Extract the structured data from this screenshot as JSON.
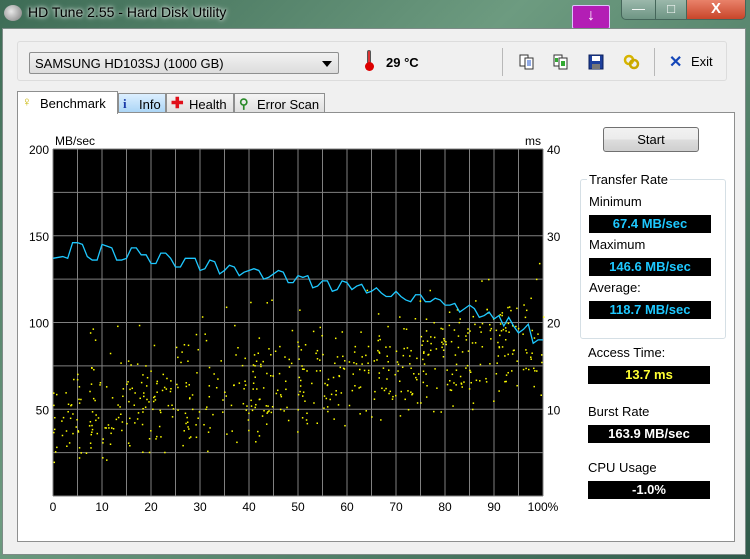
{
  "window": {
    "title": "HD Tune 2.55 - Hard Disk Utility",
    "controls": {
      "download": "↓",
      "minimize": "—",
      "maximize": "□",
      "close": "X"
    }
  },
  "toolbar": {
    "drive": "SAMSUNG HD103SJ (1000 GB)",
    "temperature": "29 °C",
    "icons": [
      "copy-text-icon",
      "copy-image-icon",
      "save-icon",
      "options-icon"
    ],
    "exit_label": "Exit"
  },
  "tabs": [
    {
      "label": "Benchmark",
      "icon": "lightbulb-icon",
      "active": true
    },
    {
      "label": "Info",
      "icon": "info-icon",
      "active": false
    },
    {
      "label": "Health",
      "icon": "health-cross-icon",
      "active": false
    },
    {
      "label": "Error Scan",
      "icon": "magnifier-icon",
      "active": false
    }
  ],
  "side": {
    "start_label": "Start",
    "transfer_rate_title": "Transfer Rate",
    "minimum_label": "Minimum",
    "minimum_value": "67.4 MB/sec",
    "maximum_label": "Maximum",
    "maximum_value": "146.6 MB/sec",
    "average_label": "Average:",
    "average_value": "118.7 MB/sec",
    "access_label": "Access Time:",
    "access_value": "13.7 ms",
    "burst_label": "Burst Rate",
    "burst_value": "163.9 MB/sec",
    "cpu_label": "CPU Usage",
    "cpu_value": "-1.0%"
  },
  "colors": {
    "transfer_line": "#1ec8ff",
    "access_points": "#ffff00",
    "plot_bg": "#000000",
    "grid": "#808080"
  },
  "chart_data": {
    "type": "line",
    "left_axis": {
      "label": "MB/sec",
      "range": [
        0,
        200
      ],
      "ticks": [
        "200",
        "150",
        "100",
        "50"
      ],
      "tick_values": [
        200,
        150,
        100,
        50
      ]
    },
    "right_axis": {
      "label": "ms",
      "range": [
        0,
        40
      ],
      "ticks": [
        "40",
        "30",
        "20",
        "10"
      ],
      "tick_values": [
        40,
        30,
        20,
        10
      ]
    },
    "x_axis": {
      "range": [
        0,
        100
      ],
      "ticks": [
        "0",
        "10",
        "20",
        "30",
        "40",
        "50",
        "60",
        "70",
        "80",
        "90",
        "100%"
      ],
      "tick_values": [
        0,
        10,
        20,
        30,
        40,
        50,
        60,
        70,
        80,
        90,
        100
      ]
    },
    "grid": true,
    "series": [
      {
        "name": "Transfer Rate (MB/sec)",
        "axis": "left",
        "x": [
          0,
          2,
          3,
          4,
          5,
          6,
          7,
          8,
          9,
          10,
          11,
          12,
          13,
          14,
          15,
          16,
          17,
          18,
          19,
          20,
          21,
          22,
          23,
          24,
          25,
          26,
          27,
          28,
          29,
          30,
          31,
          32,
          33,
          34,
          35,
          36,
          37,
          38,
          39,
          40,
          41,
          42,
          43,
          44,
          45,
          46,
          47,
          48,
          49,
          50,
          51,
          52,
          53,
          54,
          55,
          56,
          57,
          58,
          59,
          60,
          61,
          62,
          63,
          64,
          65,
          66,
          67,
          68,
          69,
          70,
          71,
          72,
          73,
          74,
          75,
          76,
          77,
          78,
          79,
          80,
          81,
          82,
          83,
          84,
          85,
          86,
          87,
          88,
          89,
          90,
          91,
          92,
          93,
          94,
          95,
          96,
          97,
          98,
          99,
          100
        ],
        "values": [
          137,
          138,
          137,
          146,
          146,
          145,
          138,
          136,
          136,
          145,
          144,
          143,
          136,
          136,
          137,
          143,
          143,
          139,
          139,
          134,
          134,
          140,
          140,
          137,
          132,
          132,
          137,
          137,
          137,
          130,
          131,
          136,
          135,
          128,
          130,
          133,
          132,
          127,
          129,
          130,
          131,
          130,
          125,
          126,
          128,
          130,
          129,
          123,
          123,
          127,
          126,
          127,
          120,
          121,
          124,
          124,
          118,
          119,
          124,
          123,
          119,
          121,
          122,
          117,
          118,
          120,
          117,
          115,
          115,
          118,
          115,
          113,
          112,
          116,
          116,
          112,
          112,
          114,
          113,
          110,
          110,
          111,
          106,
          108,
          110,
          108,
          103,
          104,
          106,
          102,
          104,
          98,
          103,
          98,
          94,
          96,
          99,
          88,
          90,
          90
        ]
      },
      {
        "name": "Access Time (ms)",
        "axis": "right",
        "type": "scatter",
        "description": "yellow scatter points, approx 4-24 ms, mean 13.7 ms"
      }
    ]
  }
}
